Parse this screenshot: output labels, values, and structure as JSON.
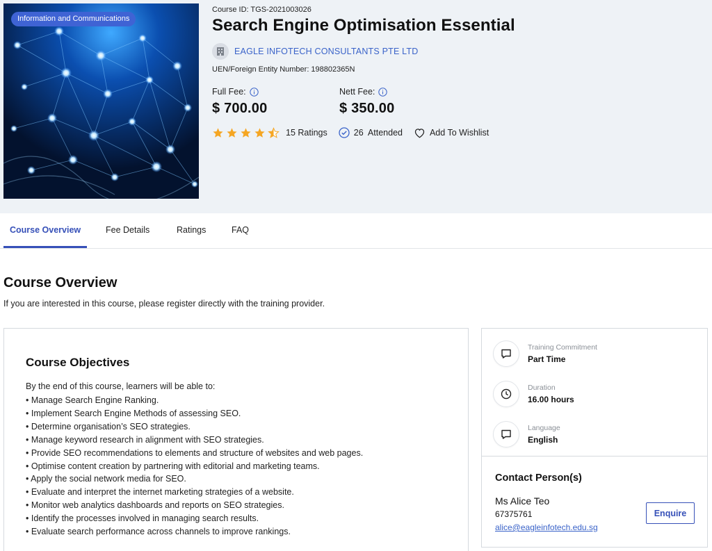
{
  "header": {
    "category_badge": "Information and Communications",
    "course_id": "Course ID: TGS-2021003026",
    "title": "Search Engine Optimisation Essential",
    "provider_name": "EAGLE INFOTECH CONSULTANTS PTE LTD",
    "uen": "UEN/Foreign Entity Number: 198802365N",
    "full_fee_label": "Full Fee:",
    "full_fee_value": "$ 700.00",
    "nett_fee_label": "Nett Fee:",
    "nett_fee_value": "$ 350.00",
    "rating_stars": 4.5,
    "ratings_text": "15 Ratings",
    "attended_text": "26  Attended",
    "wishlist_label": "Add To Wishlist"
  },
  "tabs": [
    {
      "label": "Course Overview",
      "active": true
    },
    {
      "label": "Fee Details",
      "active": false
    },
    {
      "label": "Ratings",
      "active": false
    },
    {
      "label": "FAQ",
      "active": false
    }
  ],
  "overview": {
    "title": "Course Overview",
    "subtitle": "If you are interested in this course, please register directly with the training provider.",
    "objectives_title": "Course Objectives",
    "objectives_intro": "By the end of this course, learners will be able to:",
    "objectives": [
      "• Manage Search Engine Ranking.",
      "• Implement Search Engine Methods of assessing SEO.",
      "• Determine organisation’s SEO strategies.",
      "• Manage keyword research in alignment with SEO strategies.",
      "• Provide SEO recommendations to elements and structure of websites and web pages.",
      "• Optimise content creation by partnering with editorial and marketing teams.",
      "• Apply the social network media for SEO.",
      "• Evaluate and interpret the internet marketing strategies of a website.",
      "• Monitor web analytics dashboards and reports on SEO strategies.",
      "• Identify the processes involved in managing search results.",
      "• Evaluate search performance across channels to improve rankings."
    ]
  },
  "side": {
    "items": [
      {
        "label": "Training Commitment",
        "value": "Part Time",
        "icon": "chat-icon"
      },
      {
        "label": "Duration",
        "value": "16.00 hours",
        "icon": "clock-icon"
      },
      {
        "label": "Language",
        "value": "English",
        "icon": "chat-icon"
      }
    ],
    "contact_title": "Contact Person(s)",
    "contact_name": "Ms Alice Teo",
    "contact_phone": "67375761",
    "contact_email": "alice@eagleinfotech.edu.sg",
    "enquire_label": "Enquire"
  },
  "colors": {
    "accent": "#3650b8",
    "link": "#3a63c9",
    "badge": "#3f63d4",
    "star": "#f5a623",
    "header_bg": "#eef2f6"
  }
}
